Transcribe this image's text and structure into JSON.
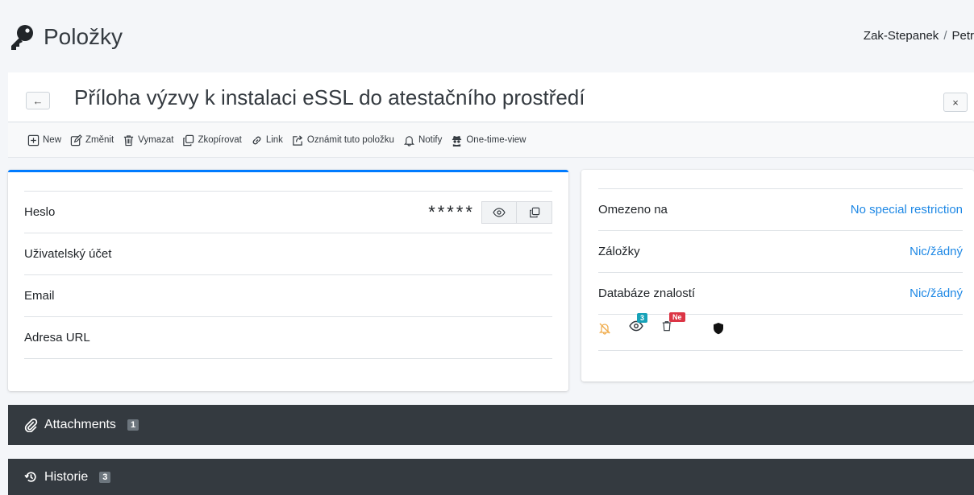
{
  "app": {
    "title": "Položky",
    "icon": "key-icon"
  },
  "breadcrumb": {
    "user": "Zak-Stepanek",
    "separator": "/",
    "next": "Petr"
  },
  "item": {
    "title": "Příloha výzvy k instalaci eSSL do atestačního prostředí",
    "back_label": "←",
    "close_label": "×"
  },
  "toolbar": {
    "new": "New",
    "edit": "Změnit",
    "delete": "Vymazat",
    "copy": "Zkopírovat",
    "link": "Link",
    "announce": "Oznámit tuto položku",
    "notify": "Notify",
    "one_time_view": "One-time-view"
  },
  "fields": {
    "password": {
      "label": "Heslo",
      "value": "*****"
    },
    "account": {
      "label": "Uživatelský účet",
      "value": ""
    },
    "email": {
      "label": "Email",
      "value": ""
    },
    "url": {
      "label": "Adresa URL",
      "value": ""
    }
  },
  "details": {
    "restricted": {
      "label": "Omezeno na",
      "value": "No special restriction"
    },
    "bookmarks": {
      "label": "Záložky",
      "value": "Nic/žádný"
    },
    "kb": {
      "label": "Databáze znalostí",
      "value": "Nic/žádný"
    }
  },
  "status_icons": {
    "views_count": "3",
    "deleted_badge": "Ne"
  },
  "colors": {
    "accent": "#007bff",
    "link": "#1e88e5",
    "dark_band": "#343a40",
    "views_badge": "#17a2b8",
    "deleted_badge": "#dc3545",
    "bell_off": "#f0ad4e"
  },
  "sections": {
    "attachments": {
      "label": "Attachments",
      "count": "1"
    },
    "history": {
      "label": "Historie",
      "count": "3"
    }
  }
}
